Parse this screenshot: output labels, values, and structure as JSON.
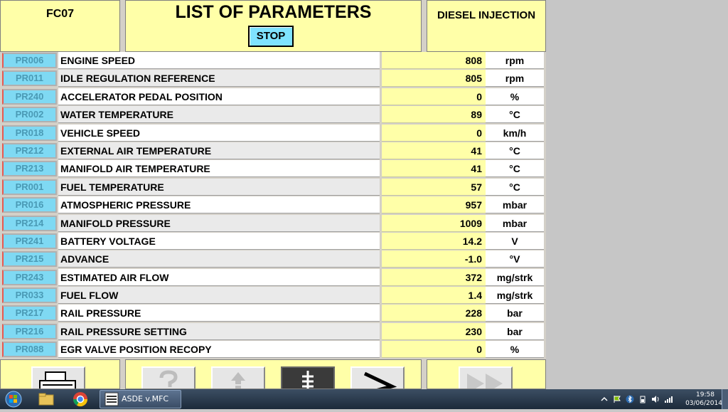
{
  "header": {
    "ecu_code": "FC07",
    "title": "LIST OF PARAMETERS",
    "stop_label": "STOP",
    "system_name": "DIESEL INJECTION"
  },
  "parameters": [
    {
      "code": "PR006",
      "name": "ENGINE SPEED",
      "value": "808",
      "unit": "rpm"
    },
    {
      "code": "PR011",
      "name": "IDLE REGULATION REFERENCE",
      "value": "805",
      "unit": "rpm"
    },
    {
      "code": "PR240",
      "name": "ACCELERATOR PEDAL POSITION",
      "value": "0",
      "unit": "%"
    },
    {
      "code": "PR002",
      "name": "WATER TEMPERATURE",
      "value": "89",
      "unit": "°C"
    },
    {
      "code": "PR018",
      "name": "VEHICLE SPEED",
      "value": "0",
      "unit": "km/h"
    },
    {
      "code": "PR212",
      "name": "EXTERNAL AIR TEMPERATURE",
      "value": "41",
      "unit": "°C"
    },
    {
      "code": "PR213",
      "name": "MANIFOLD AIR TEMPERATURE",
      "value": "41",
      "unit": "°C"
    },
    {
      "code": "PR001",
      "name": "FUEL TEMPERATURE",
      "value": "57",
      "unit": "°C"
    },
    {
      "code": "PR016",
      "name": "ATMOSPHERIC PRESSURE",
      "value": "957",
      "unit": "mbar"
    },
    {
      "code": "PR214",
      "name": "MANIFOLD PRESSURE",
      "value": "1009",
      "unit": "mbar"
    },
    {
      "code": "PR241",
      "name": "BATTERY VOLTAGE",
      "value": "14.2",
      "unit": "V"
    },
    {
      "code": "PR215",
      "name": "ADVANCE",
      "value": "-1.0",
      "unit": "°V"
    },
    {
      "code": "PR243",
      "name": "ESTIMATED AIR FLOW",
      "value": "372",
      "unit": "mg/strk"
    },
    {
      "code": "PR033",
      "name": "FUEL FLOW",
      "value": "1.4",
      "unit": "mg/strk"
    },
    {
      "code": "PR217",
      "name": "RAIL PRESSURE",
      "value": "228",
      "unit": "bar"
    },
    {
      "code": "PR216",
      "name": "RAIL PRESSURE SETTING",
      "value": "230",
      "unit": "bar"
    },
    {
      "code": "PR088",
      "name": "EGR VALVE POSITION RECOPY",
      "value": "0",
      "unit": "%"
    }
  ],
  "footer_icons": [
    "printer-icon",
    "help-icon",
    "up-arrow-icon",
    "list-icon",
    "next-arrow-icon",
    "fast-forward-icon"
  ],
  "taskbar": {
    "window_label": "ASDE v.MFC",
    "time": "19:58",
    "date": "03/06/2014"
  },
  "colors": {
    "panel_yellow": "#ffffa8",
    "code_cyan": "#7fd9f3",
    "stop_cyan": "#7fe3ff"
  }
}
